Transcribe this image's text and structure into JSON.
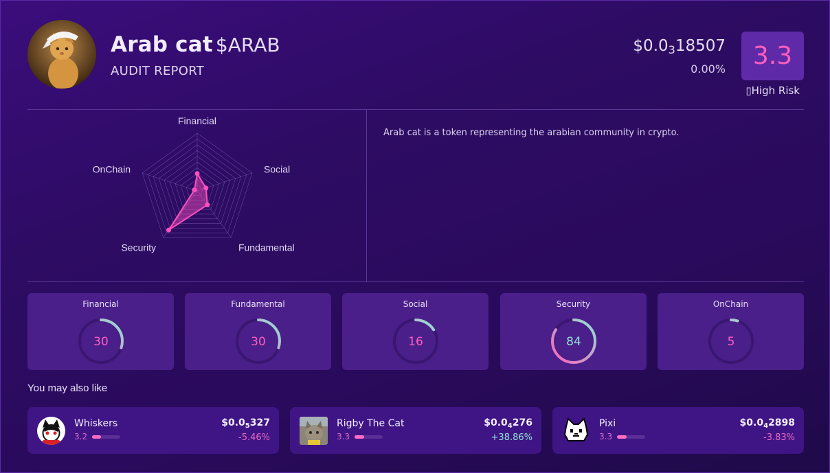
{
  "token": {
    "name": "Arab cat",
    "symbol": "$ARAB",
    "subtitle": "AUDIT REPORT",
    "price_prefix": "$0.0",
    "price_zeros": "3",
    "price_digits": "18507",
    "change": "0.00%",
    "score": "3.3",
    "risk_label": "High Risk",
    "description": "Arab cat is a token representing the arabian community in crypto."
  },
  "radar": {
    "axes": [
      "Financial",
      "Social",
      "Fundamental",
      "Security",
      "OnChain"
    ],
    "values": [
      30,
      16,
      30,
      84,
      5
    ],
    "max": 100,
    "colors": {
      "fill": "#ff4fbf",
      "grid": "#8a6bbf"
    }
  },
  "scores": [
    {
      "label": "Financial",
      "value": "30",
      "percent": 30
    },
    {
      "label": "Fundamental",
      "value": "30",
      "percent": 30
    },
    {
      "label": "Social",
      "value": "16",
      "percent": 16
    },
    {
      "label": "Security",
      "value": "84",
      "percent": 84
    },
    {
      "label": "OnChain",
      "value": "5",
      "percent": 5
    }
  ],
  "recommendations": {
    "heading": "You may also like",
    "items": [
      {
        "name": "Whiskers",
        "score": "3.2",
        "score_fraction": 0.32,
        "price_prefix": "$0.0",
        "price_zeros": "5",
        "price_digits": "327",
        "change": "-5.46%"
      },
      {
        "name": "Rigby The Cat",
        "score": "3.3",
        "score_fraction": 0.33,
        "price_prefix": "$0.0",
        "price_zeros": "4",
        "price_digits": "276",
        "change": "+38.86%"
      },
      {
        "name": "Pixi",
        "score": "3.3",
        "score_fraction": 0.33,
        "price_prefix": "$0.0",
        "price_zeros": "4",
        "price_digits": "2898",
        "change": "-3.83%"
      }
    ]
  },
  "colors": {
    "accent_pink": "#ff5fbd",
    "accent_teal": "#8fe5d3",
    "card_bg": "#4a1f8a",
    "gauge_track": "#3a1670"
  }
}
